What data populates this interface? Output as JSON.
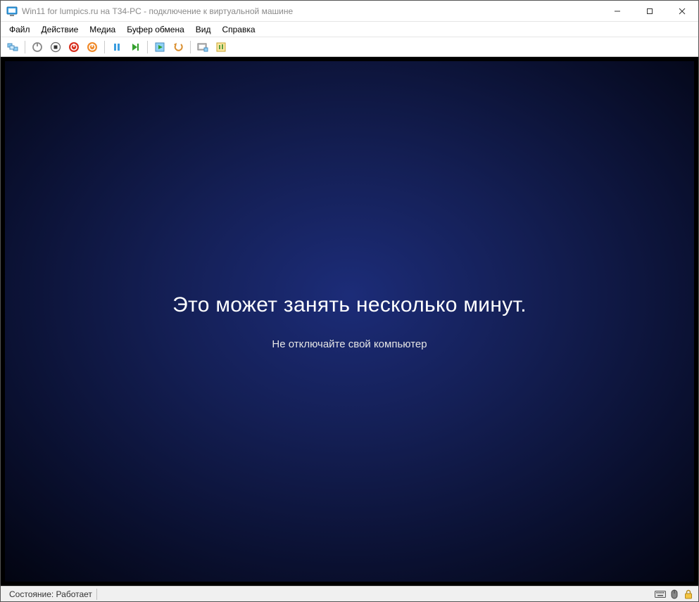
{
  "titlebar": {
    "title": "Win11 for lumpics.ru на T34-PC - подключение к виртуальной машине"
  },
  "menubar": {
    "items": [
      "Файл",
      "Действие",
      "Медиа",
      "Буфер обмена",
      "Вид",
      "Справка"
    ]
  },
  "toolbar": {
    "icons": [
      "ctrl-alt-del-icon",
      "start-icon",
      "turn-off-icon",
      "shutdown-icon",
      "save-icon",
      "pause-icon",
      "reset-icon",
      "checkpoint-icon",
      "revert-icon",
      "enhanced-session-icon",
      "share-icon"
    ]
  },
  "vm": {
    "heading": "Это может занять несколько минут.",
    "subtext": "Не отключайте свой компьютер"
  },
  "statusbar": {
    "status_label": "Состояние: Работает"
  }
}
